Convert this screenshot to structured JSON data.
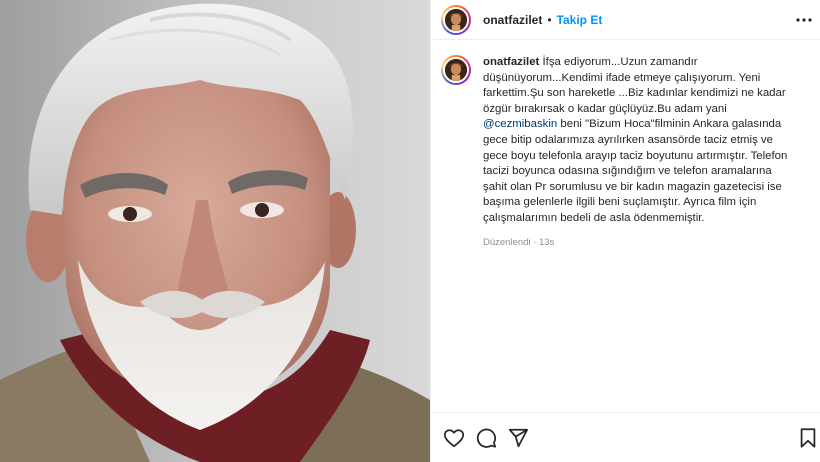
{
  "post": {
    "username": "onatfazilet",
    "separator": "•",
    "follow_label": "Takip Et"
  },
  "caption": {
    "username": "onatfazilet",
    "text_part1": "İfşa ediyorum...Uzun zamandır düşünüyorum...Kendimi ifade etmeye çalışıyorum. Yeni farkettim.Şu son hareketle ...Biz kadınlar kendimizi ne kadar özgür bırakırsak o kadar güçlüyüz.Bu adam yani ",
    "mention": "@cezmibaskin",
    "text_part2": " beni \"Bizum Hoca\"filminin Ankara galasında gece bitip odalarımıza ayrılırken asansörde taciz etmiş ve gece boyu telefonla arayıp taciz boyutunu artırmıştır. Telefon tacizi boyunca odasına sığındığım ve telefon aramalarına şahit olan Pr sorumlusu ve bir kadın magazin gazetecisi ise başıma gelenlerle ilgili beni suçlamıştır. Ayrıca film için çalışmalarımın bedeli de asla ödenmemiştir.",
    "edited_label": "Düzenlendi",
    "meta_separator": " · ",
    "time_ago": "13s"
  },
  "icons": {
    "avatar": "profile-avatar",
    "more": "more-options-icon",
    "like": "heart-icon",
    "comment": "comment-icon",
    "share": "send-icon",
    "save": "bookmark-icon"
  },
  "colors": {
    "accent": "#0095f6",
    "text": "#262626",
    "muted": "#8e8e8e",
    "mention": "#00376b"
  }
}
